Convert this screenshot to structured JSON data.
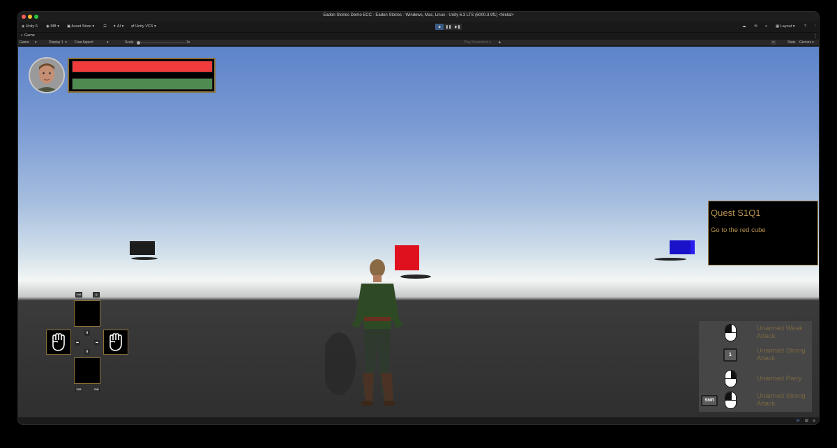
{
  "window": {
    "title": "Eadon Stories Demo ECC - Eadon Stories - Windows, Mac, Linux - Unity 6.3 LTS (6000.3.9f1) <Metal>"
  },
  "toolbar": {
    "unity_label": "Unity 6",
    "account_label": "MB",
    "asset_store_label": "Asset Store",
    "ai_label": "AI",
    "vcs_label": "Unity VCS",
    "layout_label": "Layout"
  },
  "tab": {
    "game_label": "Game"
  },
  "game_bar": {
    "view_select": "Game",
    "display_select": "Display 1",
    "aspect_select": "Free Aspect",
    "scale_label": "Scale",
    "scale_value": "1x",
    "play_mode": "Play Maximized",
    "stats_label": "Stats",
    "gizmos_label": "Gizmos"
  },
  "hud": {
    "health_color": "#f23c3c",
    "stamina_color": "#4f8a50",
    "quest": {
      "title": "Quest S1Q1",
      "description": "Go to the red cube"
    },
    "skill_keys": {
      "top_left": "Shift",
      "top_right": "Q",
      "bottom_left": "Shift",
      "bottom_right": "Shift"
    },
    "combat_hints": [
      {
        "input": "mouse-left-icon",
        "label": "Unarmed Weak Attack"
      },
      {
        "input": "key",
        "key": "1",
        "label": "Unarmed Strong Attack"
      },
      {
        "input": "mouse-right-icon",
        "label": "Unarmed Parry"
      },
      {
        "input": "shift-mouse",
        "key": "Shift",
        "label": "Unarmed Strong Attack"
      }
    ]
  },
  "scene": {
    "red_cube_color": "#e0111f",
    "blue_cube_color": "#1a12c9",
    "black_cube_color": "#1c1c1c"
  }
}
